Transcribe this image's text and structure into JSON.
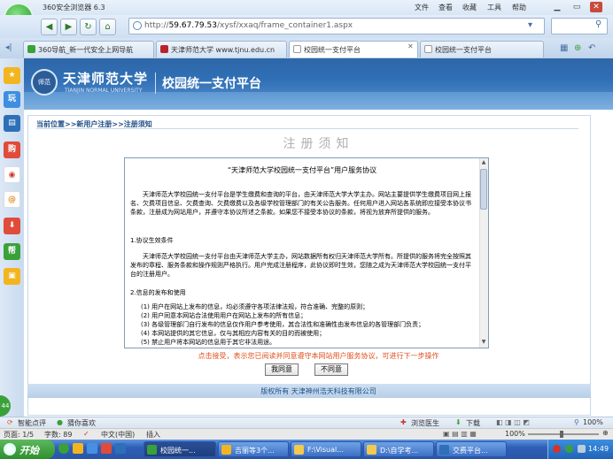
{
  "browser": {
    "title": "360安全浏览器 6.3",
    "menu": [
      "文件",
      "查看",
      "收藏",
      "工具",
      "帮助"
    ],
    "address": {
      "prefix": "http://",
      "host": "59.67.79.53",
      "path": "/xysf/xxaq/frame_container1.aspx"
    },
    "tabs": [
      {
        "label": "360导航_新一代安全上网导航"
      },
      {
        "label": "天津师范大学 www.tjnu.edu.cn"
      },
      {
        "label": "校园统一支付平台"
      },
      {
        "label": "校园统一支付平台"
      }
    ],
    "sidebar_icons": [
      "收藏",
      "玩",
      "书",
      "购",
      "微博",
      "邮",
      "下",
      "帮",
      "盒"
    ]
  },
  "page": {
    "university_name": "天津师范大学",
    "university_name_en": "TIANJIN NORMAL UNIVERSITY",
    "seal_text": "师范",
    "platform_title": "校园统一支付平台",
    "breadcrumb": "当前位置>>新用户注册>>注册须知",
    "register_title": "注册须知",
    "agreement": {
      "title": "“天津师范大学校园统一支付平台”用户服务协议",
      "p1": "天津师范大学校园统一支付平台是学生缴费和查询的平台，由天津师范大学大学主办。网站主要提供学生缴费项目网上报名、欠费项目信息、欠费查询、欠费缴费以及各级学校管理部门的有关公告服务。任何用户进入网站各系统即应接受本协议书条款，注册成为网站用户，并遵守本协议所述之条款。如果您不接受本协议的条款，将视为放弃所提供的服务。",
      "h1": "1.协议生效条件",
      "p2": "天津师范大学校园统一支付平台由天津师范大学主办，网站数据所有权归天津师范大学所有。所提供的服务将完全按照其发布的章程、服务条款和操作规则严格执行。用户完成注册程序，此协议即时生效，您随之成为天津师范大学校园统一支付平台的注册用户。",
      "h2": "2.信息的发布和使用",
      "items": [
        "(1) 用户在网站上发布的信息，均必须遵守各项法律法规，符合准确、完整的原则；",
        "(2) 用户同意本网站合法使用用户在网站上发布的所有信息；",
        "(3) 各级管理部门自行发布的信息仅作用户参考使用，其合法性和准确性由发布信息的各管理部门负责；",
        "(4) 本网站提供的其它信息，仅与其相应内容有关的目的而被使用；",
        "(5) 禁止用户将本网站的信息用于其它非法用途。"
      ]
    },
    "notice": "点击接受，表示您已阅读并同意遵守本网站用户服务协议，可进行下一步操作",
    "agree_button": "我同意",
    "disagree_button": "不同意",
    "copyright": "版权所有 天津神州浩天科技有限公司"
  },
  "statusbar": {
    "left": [
      "智能点评",
      "猜你喜欢"
    ],
    "right": [
      "浏览医生",
      "下载",
      "100%"
    ],
    "doc": [
      "页面: 1/5",
      "字数: 89",
      "中文(中国)",
      "插入"
    ],
    "zoom": "100%"
  },
  "taskbar": {
    "start": "开始",
    "tasks": [
      "校园统一...",
      "吉丽等3个...",
      "F:\\Visual...",
      "D:\\自学考...",
      "交费平台..."
    ],
    "clock": "14:49",
    "green_tag": "44"
  }
}
